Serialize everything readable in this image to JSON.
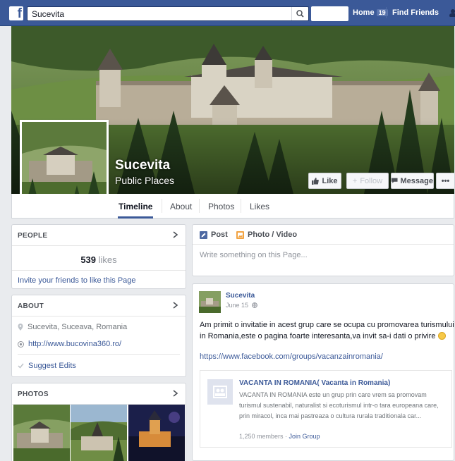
{
  "topbar": {
    "logo": "f",
    "search_value": "Sucevita",
    "home_label": "Home",
    "home_count": "19",
    "find_friends_label": "Find Friends"
  },
  "page": {
    "name": "Sucevita",
    "category": "Public Places"
  },
  "cover_buttons": {
    "like": "Like",
    "follow": "Follow",
    "message": "Message",
    "more": "•••"
  },
  "tabs": [
    "Timeline",
    "About",
    "Photos",
    "Likes"
  ],
  "people": {
    "title": "PEOPLE",
    "likes_count": "539",
    "likes_unit": "likes",
    "invite": "Invite your friends to like this Page"
  },
  "about": {
    "title": "ABOUT",
    "location": "Sucevita, Suceava, Romania",
    "website": "http://www.bucovina360.ro/",
    "suggest": "Suggest Edits"
  },
  "photos": {
    "title": "PHOTOS"
  },
  "composer": {
    "post_tab": "Post",
    "photo_tab": "Photo / Video",
    "placeholder": "Write something on this Page..."
  },
  "post": {
    "author": "Sucevita",
    "date": "June 15",
    "text": "Am primit o invitatie in acest grup care se ocupa cu promovarea turismului in Romania,este o pagina foarte interesanta,va invit sa-i dati o privire",
    "link": "https://www.facebook.com/groups/vacanzainromania/",
    "share_title": "VACANTA IN ROMANIA( Vacanta in Romania)",
    "share_desc": "VACANTA IN ROMANIA este un grup prin care vrem sa promovam turismul sustenabil, naturalist si ecoturismul intr-o tara europeana care, prin miracol, inca mai pastreaza o cultura rurala traditionala car...",
    "share_members": "1,250 members",
    "share_join": "Join Group"
  },
  "colors": {
    "facebook_blue": "#3b5998",
    "link": "#3b5998",
    "background": "#e9ebee"
  }
}
